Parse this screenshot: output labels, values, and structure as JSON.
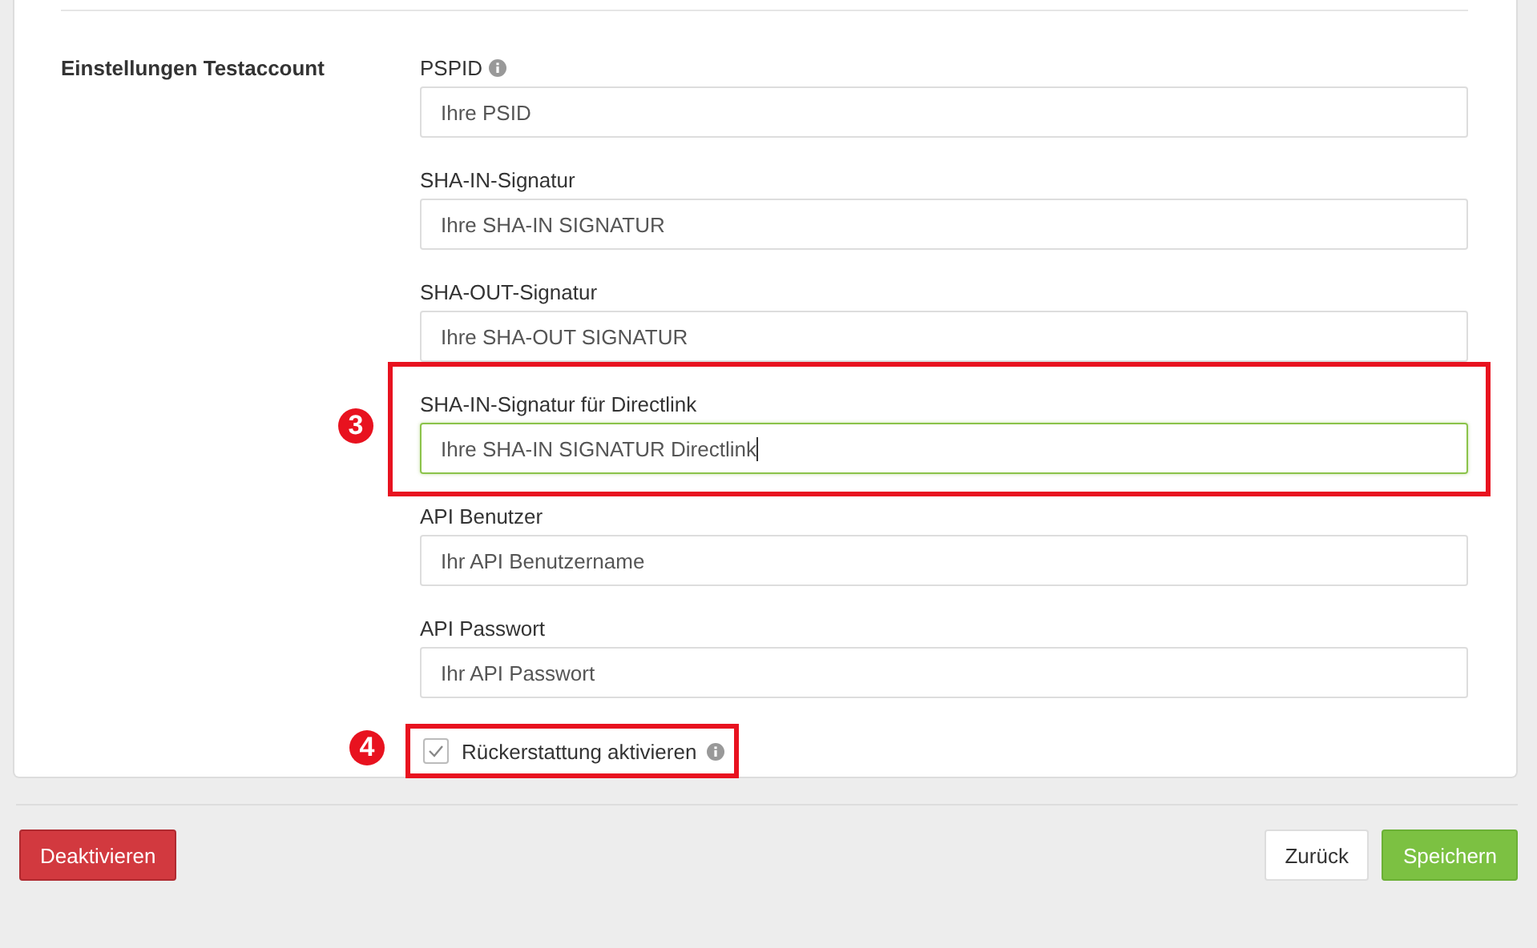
{
  "section": {
    "title": "Einstellungen Testaccount"
  },
  "fields": [
    {
      "label": "PSPID",
      "info": true,
      "value": "Ihre PSID",
      "focused": false
    },
    {
      "label": "SHA-IN-Signatur",
      "info": false,
      "value": "Ihre SHA-IN SIGNATUR",
      "focused": false
    },
    {
      "label": "SHA-OUT-Signatur",
      "info": false,
      "value": "Ihre SHA-OUT SIGNATUR",
      "focused": false
    },
    {
      "label": "SHA-IN-Signatur für Directlink",
      "info": false,
      "value": "Ihre SHA-IN SIGNATUR Directlink",
      "focused": true,
      "annotation": "3"
    },
    {
      "label": "API Benutzer",
      "info": false,
      "value": "Ihr API Benutzername",
      "focused": false
    },
    {
      "label": "API Passwort",
      "info": false,
      "value": "Ihr API Passwort",
      "focused": false
    }
  ],
  "checkbox": {
    "label": "Rückerstattung aktivieren",
    "checked": true,
    "info": true,
    "annotation": "4"
  },
  "footer": {
    "left_button": "Deaktivieren",
    "buttons": [
      "Zurück",
      "Speichern"
    ]
  }
}
